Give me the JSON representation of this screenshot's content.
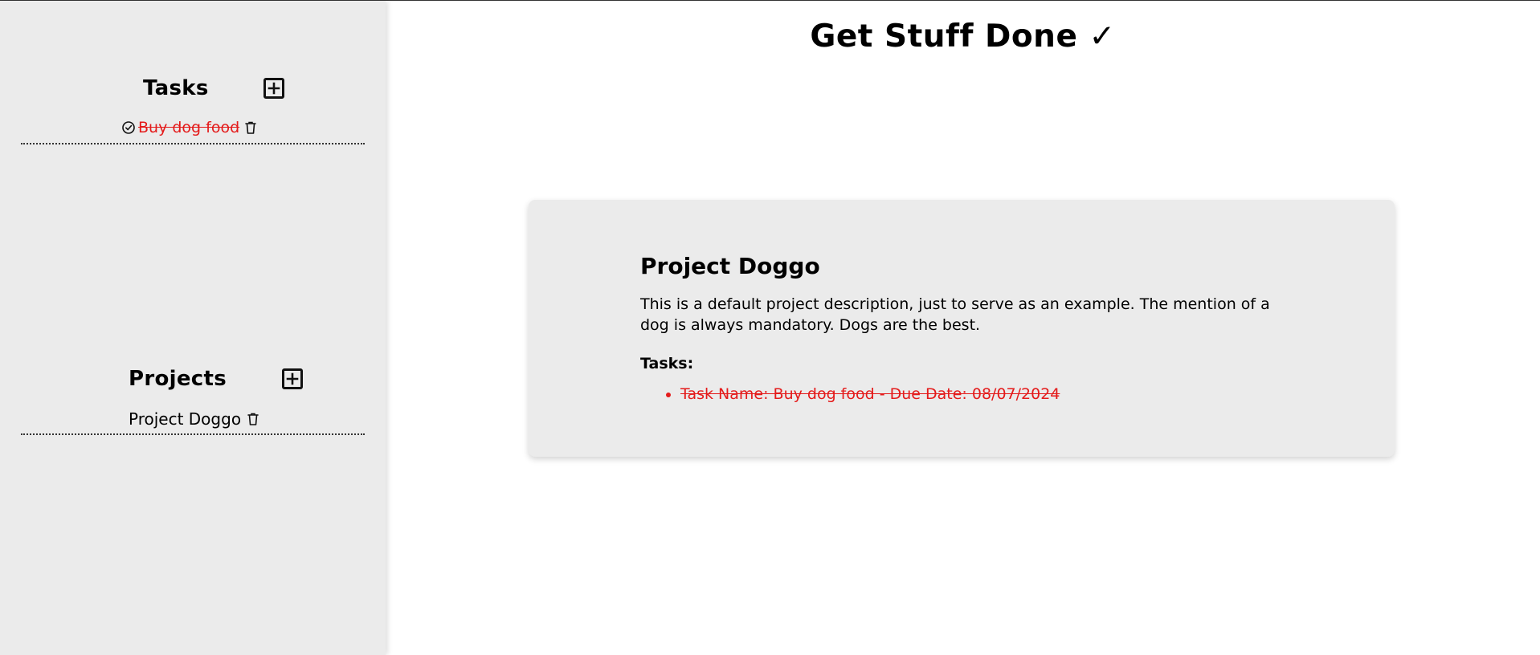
{
  "app": {
    "title": "Get Stuff Done ✓"
  },
  "sidebar": {
    "tasks_section": {
      "title": "Tasks",
      "items": [
        {
          "label": "Buy dog food",
          "completed": true
        }
      ]
    },
    "projects_section": {
      "title": "Projects",
      "items": [
        {
          "label": "Project Doggo"
        }
      ]
    }
  },
  "project_card": {
    "title": "Project Doggo",
    "description": "This is a default project description, just to serve as an example. The mention of a dog is always mandatory. Dogs are the best.",
    "tasks_label": "Tasks:",
    "tasks": [
      "Task Name: Buy dog food - Due Date: 08/07/2024"
    ]
  },
  "colors": {
    "sidebar_bg": "#ebebeb",
    "completed_text": "#e41b1b",
    "card_bg": "#ebebeb"
  },
  "icons": {
    "add": "plus-square-icon",
    "check": "check-circle-icon",
    "delete": "trash-icon"
  }
}
